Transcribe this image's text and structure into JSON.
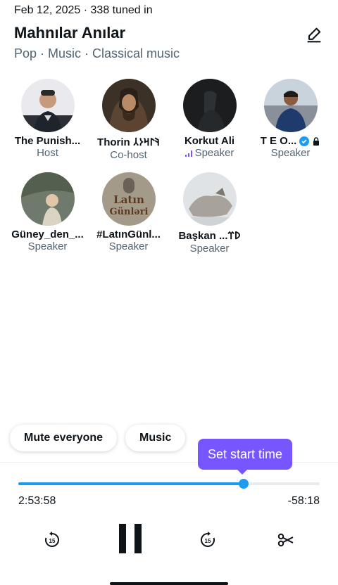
{
  "space": {
    "meta": "Feb 12, 2025 · 338 tuned in",
    "title": "Mahnılar Anılar",
    "tags": "Pop · Music · Classical music"
  },
  "participants": [
    {
      "name": "The Punish...",
      "role": "Host"
    },
    {
      "name": "Thorin 𐰚𐰃𐰺𐰆𐰲",
      "role": "Co-host"
    },
    {
      "name": "Korkut Ali",
      "role": "Speaker"
    },
    {
      "name": "T E O...",
      "role": "Speaker"
    },
    {
      "name": "Güney_den_...",
      "role": "Speaker"
    },
    {
      "name": "#LatınGünl...",
      "role": "Speaker"
    },
    {
      "name": "Başkan ...𐰖𐰼",
      "role": "Speaker"
    }
  ],
  "avatar_text": {
    "latin_line1": "Latın",
    "latin_line2": "Günləri"
  },
  "chips": {
    "mute": "Mute everyone",
    "music": "Music"
  },
  "tooltip": "Set start time",
  "playback": {
    "elapsed": "2:53:58",
    "remaining": "-58:18",
    "progress": 0.747
  },
  "controls": {
    "rewind_seconds": "15",
    "forward_seconds": "15"
  },
  "colors": {
    "accent": "#1d9bf0",
    "purple": "#7856ff"
  }
}
